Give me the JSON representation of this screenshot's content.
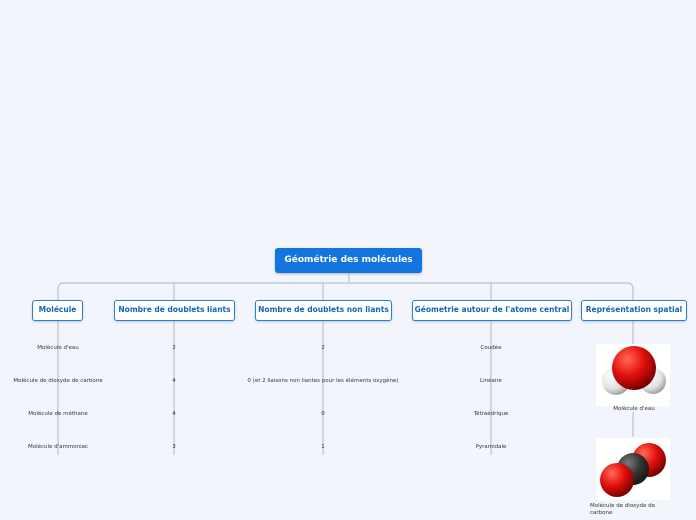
{
  "root": {
    "label": "Géométrie des molécules"
  },
  "branches": [
    {
      "label": "Molécule",
      "leaves": [
        "Molécule d'eau",
        "Molécule de dioxyde de carbone",
        "Molécule de méthane",
        "Molécule d'ammoniac"
      ]
    },
    {
      "label": "Nombre de doublets liants",
      "leaves": [
        "2",
        "4",
        "4",
        "3"
      ]
    },
    {
      "label": "Nombre de doublets non liants",
      "leaves": [
        "2",
        "0 (et 2 liaisons non liantes pour les éléments oxygène)",
        "0",
        "1"
      ]
    },
    {
      "label": "Géometrie autour de l'atome central",
      "leaves": [
        "Coudée",
        "Linéaire",
        "Tétraédrique",
        "Pyramidale"
      ]
    },
    {
      "label": "Représentation spatial",
      "images": [
        {
          "caption": "Molécule d'eau",
          "icon": "water-molecule-icon"
        },
        {
          "caption": "Molécule de dioxyde de carbone",
          "icon": "carbon-dioxide-molecule-icon"
        }
      ]
    }
  ],
  "colors": {
    "root_fill": "#1376e0",
    "branch_border": "#2a7fd4",
    "branch_text": "#1464b8",
    "connector": "#b9c3d3",
    "background": "#f2f5fc"
  }
}
